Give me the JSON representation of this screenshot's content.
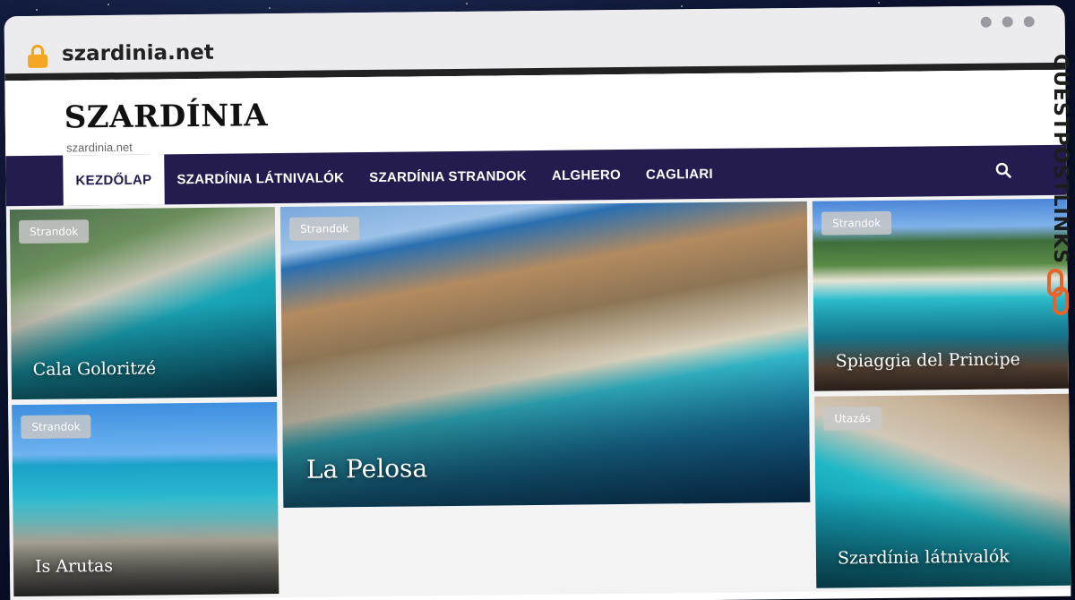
{
  "browser": {
    "url": "szardinia.net",
    "lock_icon": "lock-icon",
    "window_dots": [
      "dot",
      "dot",
      "dot"
    ]
  },
  "site": {
    "title": "SZARDÍNIA",
    "tagline": "szardinia.net"
  },
  "nav": {
    "items": [
      {
        "label": "KEZDŐLAP",
        "active": true
      },
      {
        "label": "SZARDÍNIA LÁTNIVALÓK",
        "active": false
      },
      {
        "label": "SZARDÍNIA STRANDOK",
        "active": false
      },
      {
        "label": "ALGHERO",
        "active": false
      },
      {
        "label": "CAGLIARI",
        "active": false
      }
    ],
    "search_icon": "search-icon"
  },
  "cards": [
    {
      "badge": "Strandok",
      "title": "Cala Goloritzé"
    },
    {
      "badge": "Strandok",
      "title": "Is Arutas"
    },
    {
      "badge": "Strandok",
      "title": "La Pelosa"
    },
    {
      "badge": "Strandok",
      "title": "Spiaggia del Principe"
    },
    {
      "badge": "Utazás",
      "title": "Szardínia látnivalók"
    }
  ],
  "watermark": {
    "text": "GUESTPOSTLINKS",
    "accent_color": "#e8622a"
  }
}
